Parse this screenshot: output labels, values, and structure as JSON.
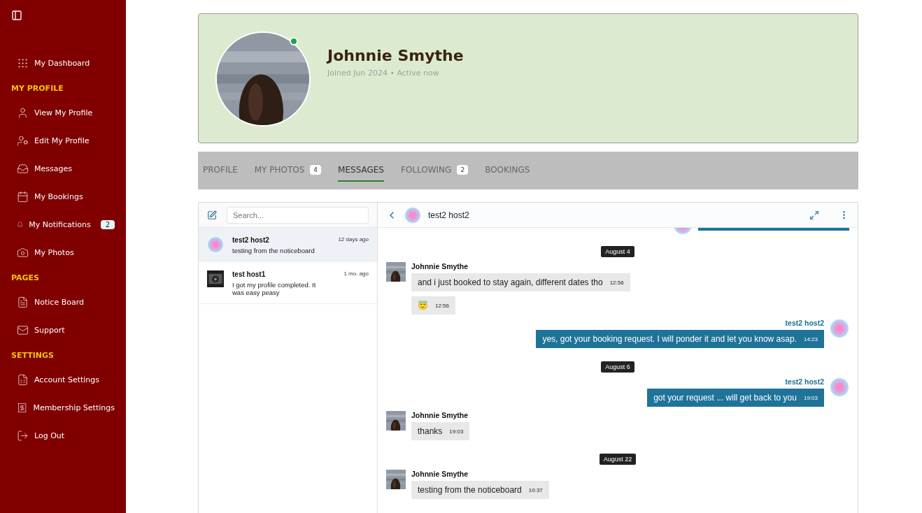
{
  "sidebar": {
    "sections": [
      {
        "items": [
          {
            "label": "My Dashboard"
          }
        ]
      },
      {
        "heading": "MY PROFILE",
        "items": [
          {
            "label": "View My Profile"
          },
          {
            "label": "Edit My Profile"
          },
          {
            "label": "Messages"
          },
          {
            "label": "My Bookings"
          },
          {
            "label": "My Notifications",
            "badge": "2"
          },
          {
            "label": "My Photos"
          }
        ]
      },
      {
        "heading": "PAGES",
        "items": [
          {
            "label": "Notice Board"
          },
          {
            "label": "Support"
          }
        ]
      },
      {
        "heading": "SETTINGS",
        "items": [
          {
            "label": "Account Settings"
          },
          {
            "label": "Membership Settings"
          },
          {
            "label": "Log Out"
          }
        ]
      }
    ]
  },
  "profile": {
    "name": "Johnnie Smythe",
    "meta": "Joined Jun 2024 • Active now",
    "online": true
  },
  "tabs": [
    {
      "label": "PROFILE",
      "selected": false
    },
    {
      "label": "MY PHOTOS",
      "badge": "4",
      "selected": false
    },
    {
      "label": "MESSAGES",
      "selected": true
    },
    {
      "label": "FOLLOWING",
      "badge": "2",
      "selected": false
    },
    {
      "label": "BOOKINGS",
      "selected": false
    }
  ],
  "inbox": {
    "search": {
      "placeholder": "Search..."
    },
    "conversations": [
      {
        "name": "test2 host2",
        "preview": "testing from the noticeboard",
        "time": "12 days ago",
        "selected": true
      },
      {
        "name": "test host1",
        "preview": "I got my profile completed. It was easy peasy",
        "time": "1 mo. ago",
        "selected": false
      }
    ]
  },
  "chat": {
    "title": "test2 host2",
    "messages": [
      {
        "kind": "out-cut"
      },
      {
        "kind": "date",
        "text": "August 4"
      },
      {
        "kind": "in",
        "sender": "Johnnie Smythe",
        "bubbles": [
          {
            "text": "and i just booked to stay again, different dates tho",
            "time": "12:56"
          },
          {
            "text": "😇",
            "time": "12:56"
          }
        ]
      },
      {
        "kind": "out",
        "sender": "test2 host2",
        "bubbles": [
          {
            "text": "yes, got your booking request. I will ponder it and let you know asap.",
            "time": "14:23"
          }
        ]
      },
      {
        "kind": "date",
        "text": "August 6"
      },
      {
        "kind": "out",
        "sender": "test2 host2",
        "bubbles": [
          {
            "text": "got your request ... will get back to you",
            "time": "19:03"
          }
        ]
      },
      {
        "kind": "in",
        "sender": "Johnnie Smythe",
        "bubbles": [
          {
            "text": "thanks",
            "time": "19:03"
          }
        ]
      },
      {
        "kind": "date",
        "text": "August 22"
      },
      {
        "kind": "in",
        "sender": "Johnnie Smythe",
        "bubbles": [
          {
            "text": "testing from the noticeboard",
            "time": "10:37"
          }
        ]
      }
    ]
  }
}
